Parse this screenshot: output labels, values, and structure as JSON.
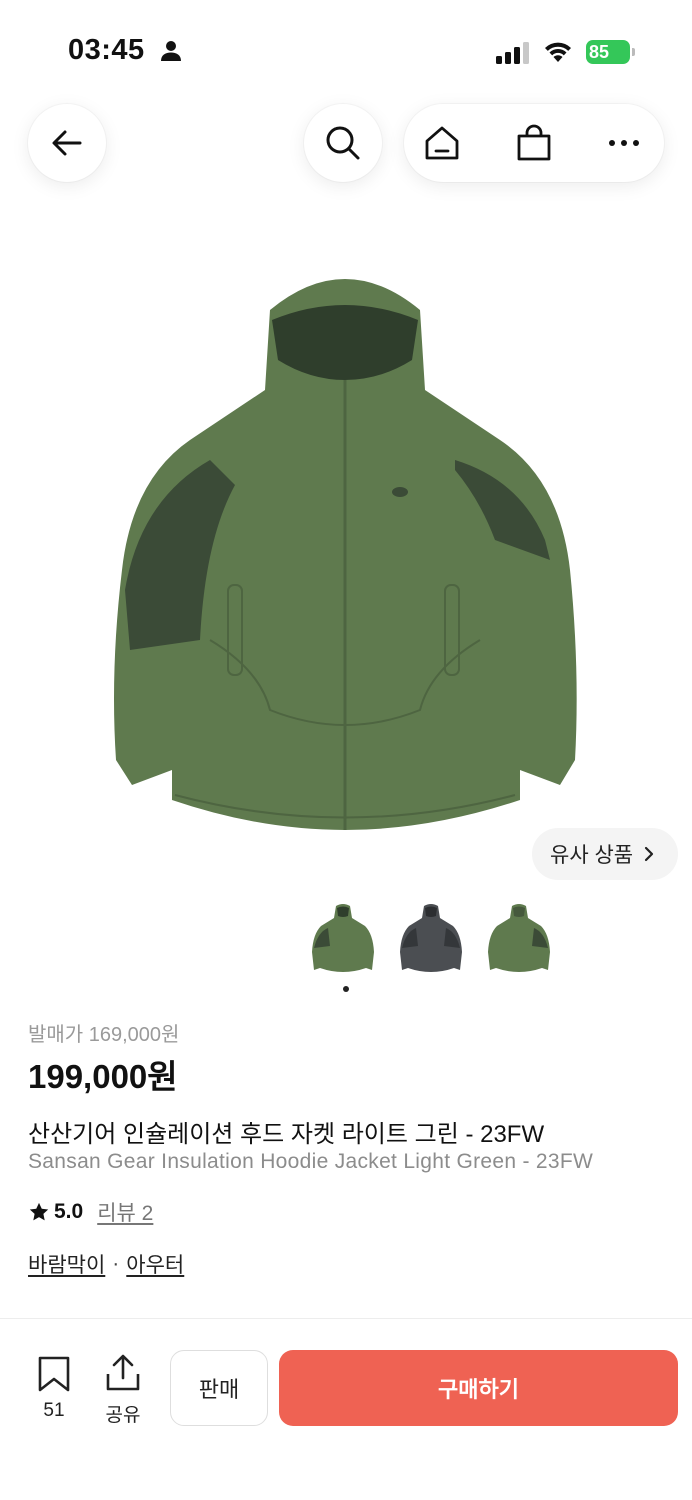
{
  "status_bar": {
    "time": "03:45",
    "battery": "85"
  },
  "nav": {
    "icons": [
      "back-arrow-icon",
      "search-icon",
      "home-icon",
      "shopping-bag-icon",
      "more-icon"
    ]
  },
  "product": {
    "similar_label": "유사 상품",
    "thumbnails": [
      "green-jacket",
      "gray-jacket",
      "green-jacket-back"
    ],
    "selected_thumbnail_index": 0,
    "msrp": "발매가 169,000원",
    "price": "199,000원",
    "title_ko": "산산기어 인슐레이션 후드 자켓 라이트 그린 - 23FW",
    "title_en": "Sansan Gear Insulation Hoodie Jacket Light Green - 23FW",
    "rating": "5.0",
    "reviews_label": "리뷰 2",
    "categories": [
      "바람막이",
      "아우터"
    ],
    "category_separator": "·"
  },
  "bottom_bar": {
    "bookmark_count": "51",
    "share_label": "공유",
    "sell_label": "판매",
    "buy_label": "구매하기"
  },
  "colors": {
    "buy_button": "#ef6253",
    "battery": "#34c759",
    "jacket_green": "#5f7a4e",
    "jacket_dark_panel": "#3b4b37",
    "jacket_gray": "#4b4e52"
  }
}
